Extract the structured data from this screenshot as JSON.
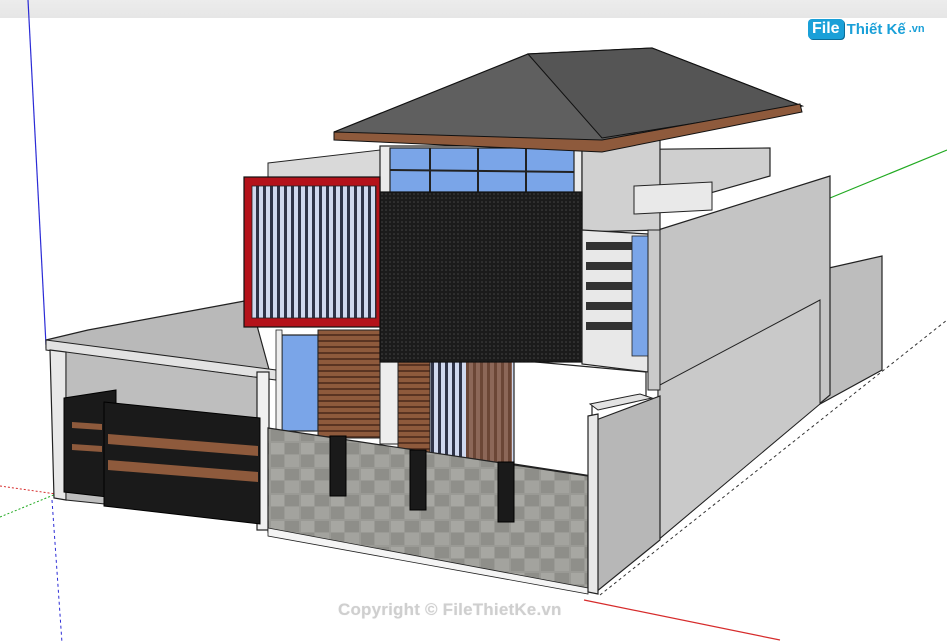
{
  "app": {
    "window": "3D modeling viewport"
  },
  "watermark": {
    "logo_badge": "File",
    "logo_name": "Thiết Kế",
    "logo_domain": ".vn",
    "copyright": "Copyright © FileThietKe.vn"
  },
  "colors": {
    "axis_blue": "#2b2bd6",
    "axis_green": "#22aa22",
    "axis_red": "#d62b2b",
    "roof": "#5f5f5f",
    "frame_red": "#b4121a",
    "wood": "#8e5a3c",
    "glass": "#7aa5e8",
    "wall": "#c8c8c8",
    "stone": "#9a9a95"
  },
  "model": {
    "subject": "two-storey house with hipped roof"
  }
}
